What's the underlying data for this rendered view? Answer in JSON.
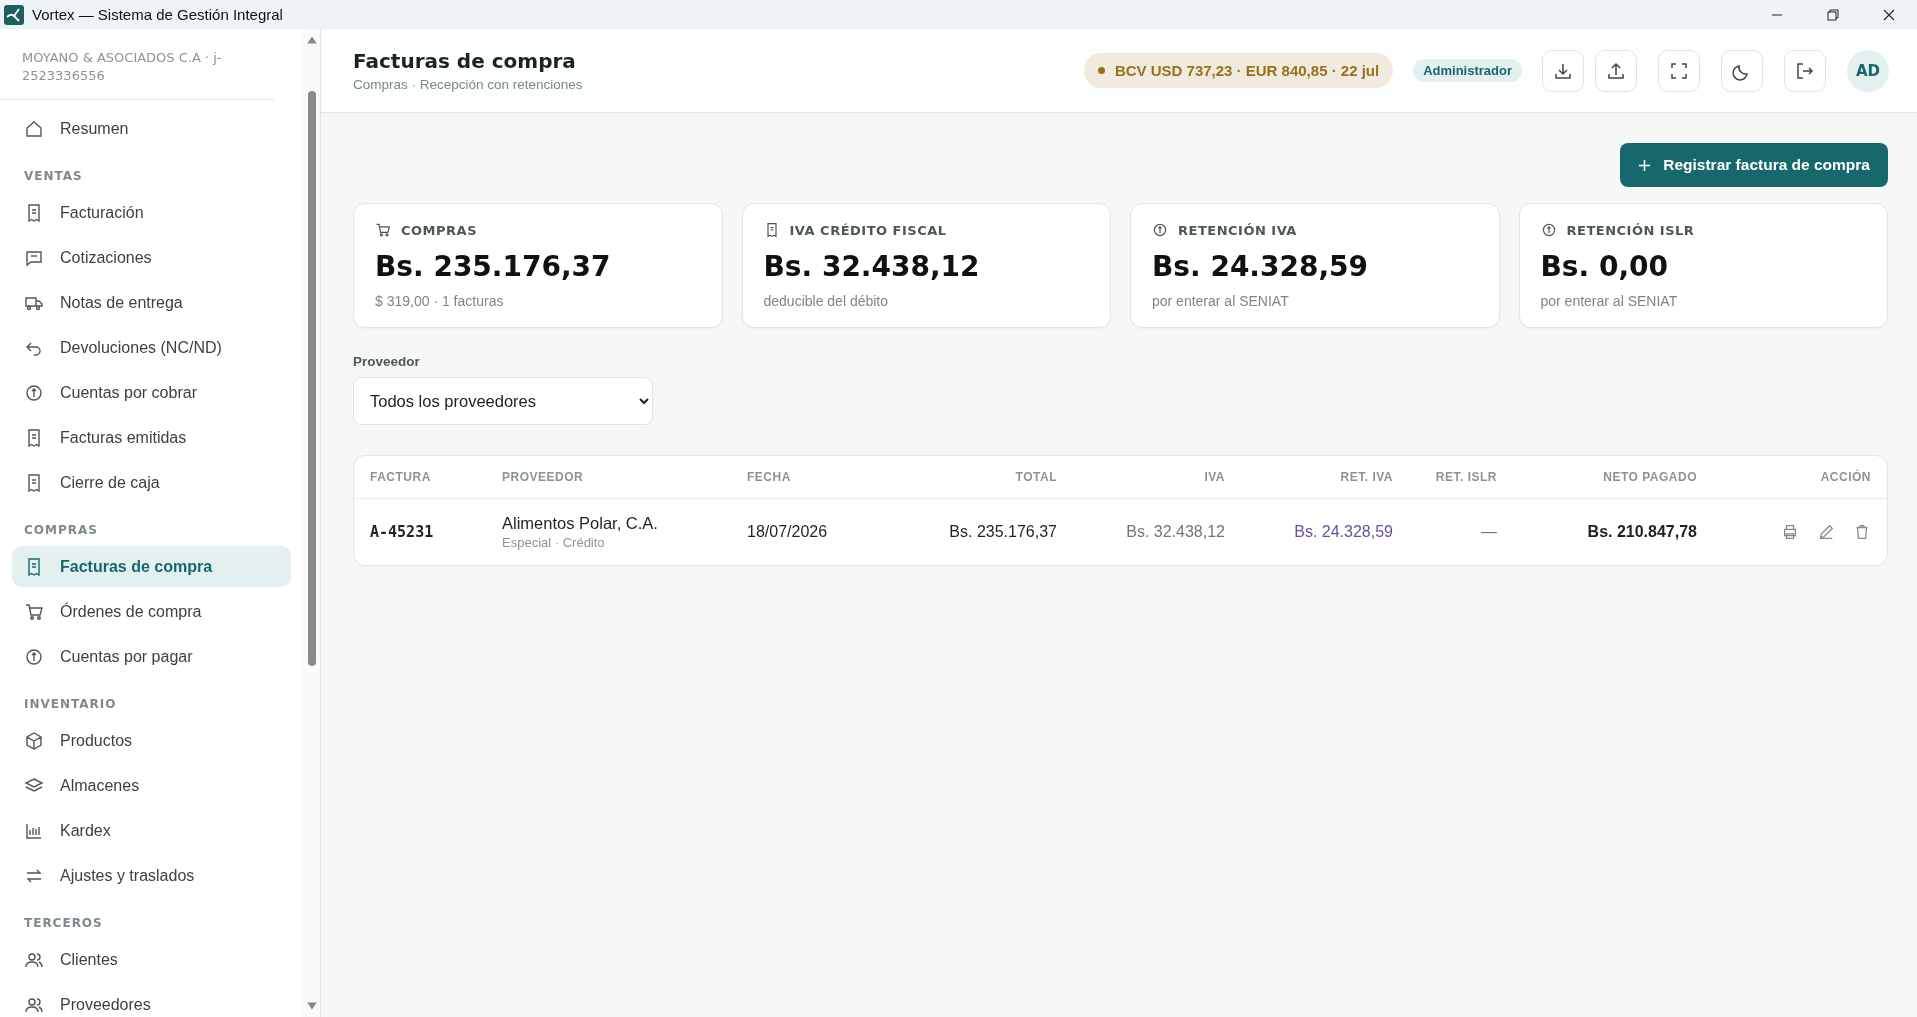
{
  "window": {
    "title": "Vortex — Sistema de Gestión Integral"
  },
  "sidebar": {
    "company": "MOYANO & ASOCIADOS C.A · j-2523336556",
    "top_items": [
      {
        "label": "Resumen",
        "selected": false
      }
    ],
    "sections": [
      {
        "title": "VENTAS",
        "items": [
          {
            "label": "Facturación",
            "selected": false
          },
          {
            "label": "Cotizaciones",
            "selected": false
          },
          {
            "label": "Notas de entrega",
            "selected": false
          },
          {
            "label": "Devoluciones (NC/ND)",
            "selected": false
          },
          {
            "label": "Cuentas por cobrar",
            "selected": false
          },
          {
            "label": "Facturas emitidas",
            "selected": false
          },
          {
            "label": "Cierre de caja",
            "selected": false
          }
        ]
      },
      {
        "title": "COMPRAS",
        "items": [
          {
            "label": "Facturas de compra",
            "selected": true
          },
          {
            "label": "Órdenes de compra",
            "selected": false
          },
          {
            "label": "Cuentas por pagar",
            "selected": false
          }
        ]
      },
      {
        "title": "INVENTARIO",
        "items": [
          {
            "label": "Productos",
            "selected": false
          },
          {
            "label": "Almacenes",
            "selected": false
          },
          {
            "label": "Kardex",
            "selected": false
          },
          {
            "label": "Ajustes y traslados",
            "selected": false
          }
        ]
      },
      {
        "title": "TERCEROS",
        "items": [
          {
            "label": "Clientes",
            "selected": false
          },
          {
            "label": "Proveedores",
            "selected": false
          }
        ]
      }
    ]
  },
  "header": {
    "title": "Facturas de compra",
    "subtitle": "Compras · Recepción con retenciones",
    "rate": "BCV USD 737,23 · EUR 840,85 · 22 jul",
    "role": "Administrador",
    "avatar": "AD"
  },
  "primary_button": "Registrar factura de compra",
  "stats": [
    {
      "label": "COMPRAS",
      "value": "Bs. 235.176,37",
      "note": "$ 319,00 · 1 facturas"
    },
    {
      "label": "IVA CRÉDITO FISCAL",
      "value": "Bs. 32.438,12",
      "note": "deducible del débito"
    },
    {
      "label": "RETENCIÓN IVA",
      "value": "Bs. 24.328,59",
      "note": "por enterar al SENIAT"
    },
    {
      "label": "RETENCIÓN ISLR",
      "value": "Bs. 0,00",
      "note": "por enterar al SENIAT"
    }
  ],
  "filter": {
    "label": "Proveedor",
    "value": "Todos los proveedores"
  },
  "table": {
    "columns": [
      "FACTURA",
      "PROVEEDOR",
      "FECHA",
      "TOTAL",
      "IVA",
      "RET. IVA",
      "RET. ISLR",
      "NETO PAGADO",
      "ACCIÓN"
    ],
    "rows": [
      {
        "invoice": "A-45231",
        "supplier": "Alimentos Polar, C.A.",
        "supplier_note": "Especial · Crédito",
        "date": "18/07/2026",
        "total": "Bs. 235.176,37",
        "iva": "Bs. 32.438,12",
        "ret_iva": "Bs. 24.328,59",
        "ret_islr": "—",
        "net": "Bs. 210.847,78"
      }
    ]
  }
}
